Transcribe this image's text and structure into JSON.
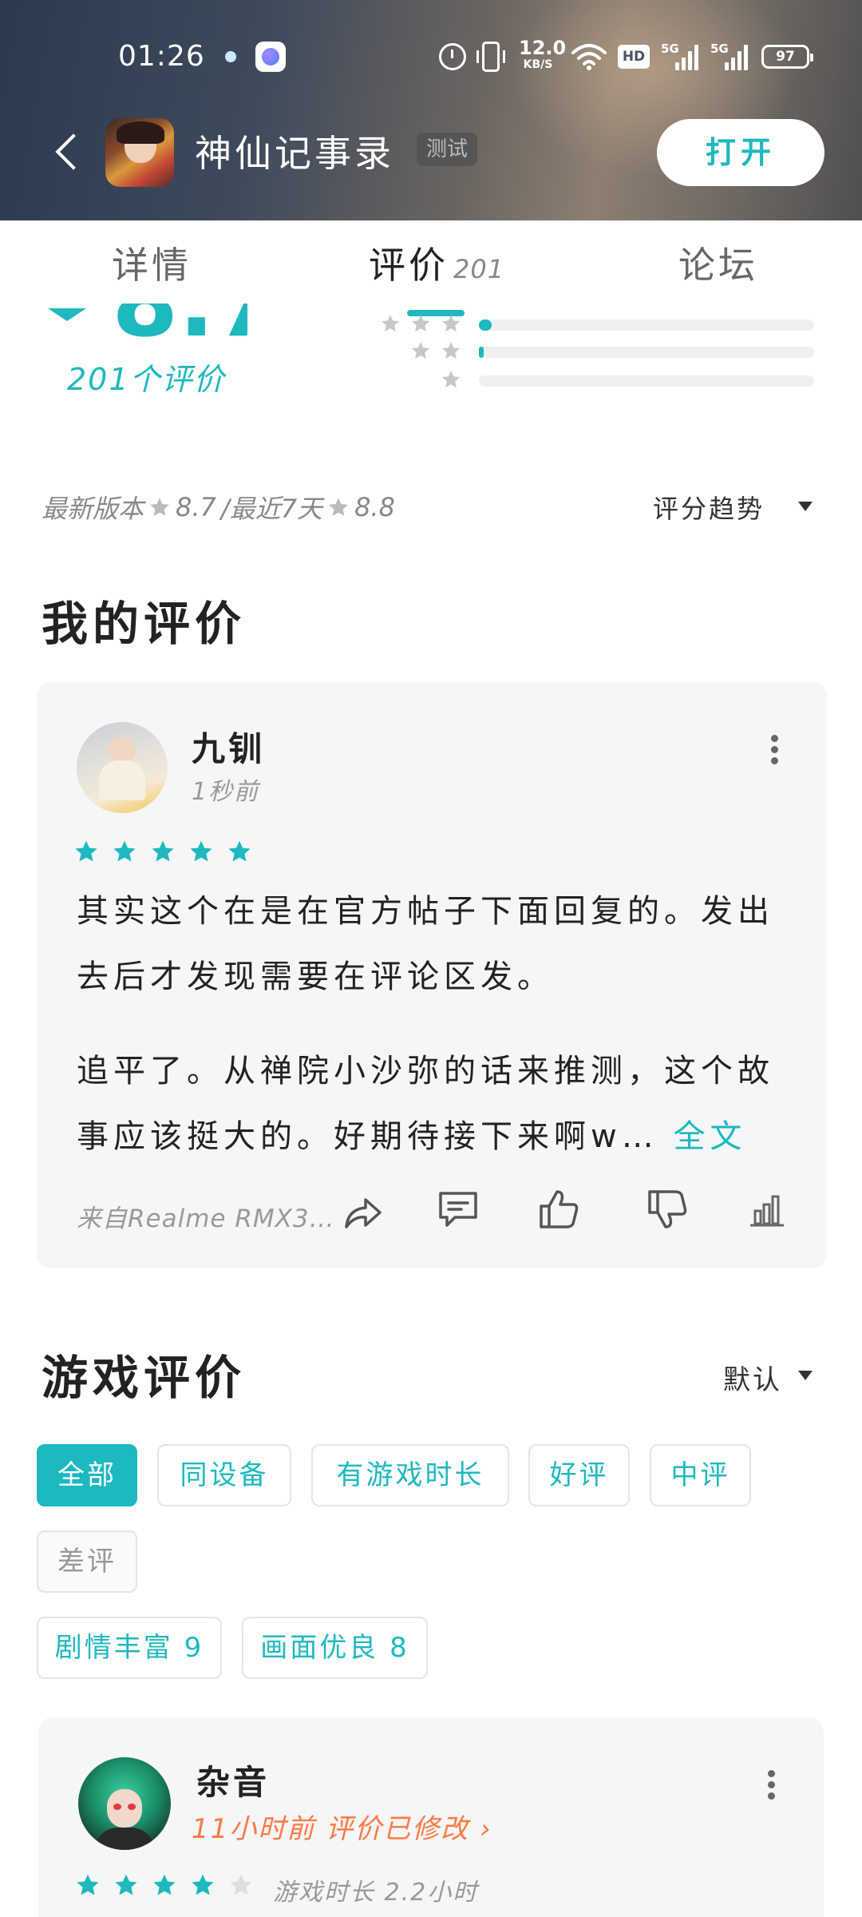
{
  "status_bar": {
    "time": "01:26",
    "net_speed_value": "12.0",
    "net_speed_unit": "KB/S",
    "hd_label": "HD",
    "signal1_label": "5G",
    "signal2_label": "5G",
    "battery": "97"
  },
  "header": {
    "app_name": "神仙记事录",
    "tag": "测试",
    "open_label": "打开"
  },
  "tabs": [
    {
      "label": "详情"
    },
    {
      "label": "评价",
      "count": "201"
    },
    {
      "label": "论坛"
    }
  ],
  "rating": {
    "score_partial": "8.7",
    "count_label": "201个评价",
    "distribution": [
      {
        "stars": 3,
        "fraction": 0.02
      },
      {
        "stars": 2,
        "fraction": 0.01
      },
      {
        "stars": 1,
        "fraction": 0.0
      }
    ],
    "latest_version_label": "最新版本",
    "latest_version_score": "8.7",
    "separator": "/最近7天",
    "recent_score": "8.8",
    "trend_label": "评分趋势"
  },
  "my_review": {
    "section_title": "我的评价",
    "user": "九钏",
    "time": "1秒前",
    "stars": 5,
    "paragraph1": "其实这个在是在官方帖子下面回复的。发出去后才发现需要在评论区发。",
    "paragraph2_line1": "追平了。从禅院小沙弥的话来推测，这个故",
    "paragraph2_line2": "事应该挺大的。好期待接下来啊w…",
    "full_text_link": "全文",
    "device": "来自Realme RMX3…"
  },
  "game_reviews": {
    "section_title": "游戏评价",
    "sort_label": "默认",
    "filters": [
      {
        "label": "全部",
        "active": true
      },
      {
        "label": "同设备"
      },
      {
        "label": "有游戏时长"
      },
      {
        "label": "好评"
      },
      {
        "label": "中评"
      },
      {
        "label": "差评",
        "muted": true
      }
    ],
    "tags": [
      {
        "label": "剧情丰富 9"
      },
      {
        "label": "画面优良 8"
      }
    ],
    "first_review": {
      "user": "杂音",
      "meta": "11小时前 评价已修改",
      "stars": 4,
      "play_time": "游戏时长 2.2小时"
    }
  },
  "colors": {
    "accent": "#1eb8bf",
    "orange": "#ff7a45",
    "card_bg": "#f5f6f7"
  }
}
